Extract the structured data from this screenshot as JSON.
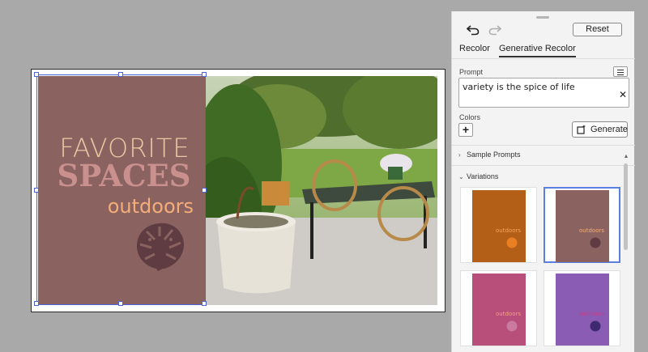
{
  "poster": {
    "line1": "FAVORITE",
    "line2": "SPACES",
    "line3": "outdoors",
    "background": "#8a6361"
  },
  "panel": {
    "toolbar": {
      "undo_icon": "undo-icon",
      "redo_icon": "redo-icon",
      "reset_label": "Reset"
    },
    "tabs": [
      {
        "label": "Recolor",
        "active": false
      },
      {
        "label": "Generative Recolor",
        "active": true
      }
    ],
    "prompt": {
      "label": "Prompt",
      "value": "variety is the spice of life",
      "clear_icon": "close-icon",
      "menu_icon": "menu-icon"
    },
    "colors": {
      "label": "Colors",
      "add_icon": "plus-icon"
    },
    "generate_label": "Generate",
    "sample_prompts_label": "Sample Prompts",
    "variations_label": "Variations",
    "variations": [
      {
        "bg": "#b35f18",
        "text": "outdoors",
        "text_color": "#f7a35b",
        "leaf": "#ea7e22",
        "selected": false
      },
      {
        "bg": "#8a6361",
        "text": "outdoors",
        "text_color": "#f4ad79",
        "leaf": "#5e3c42",
        "selected": true
      },
      {
        "bg": "#b84e7a",
        "text": "outdoors",
        "text_color": "#f4a37a",
        "leaf": "#c97a9e",
        "selected": false
      },
      {
        "bg": "#8a5cb3",
        "text": "outdoors",
        "text_color": "#c23e8a",
        "leaf": "#3f2a72",
        "selected": false
      }
    ]
  }
}
